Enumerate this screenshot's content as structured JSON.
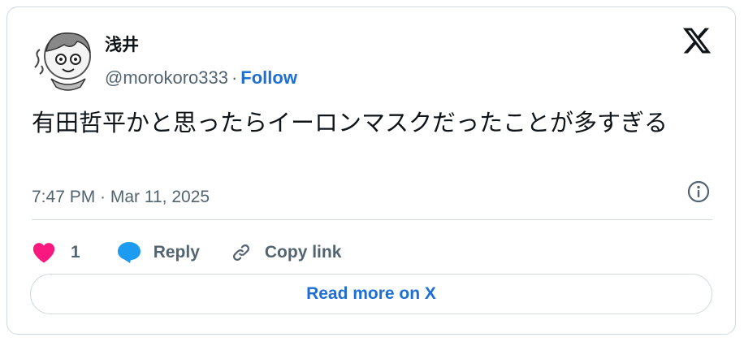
{
  "author": {
    "name": "浅井",
    "handle": "@morokoro333",
    "separator": "·",
    "follow_label": "Follow"
  },
  "tweet": {
    "text": "有田哲平かと思ったらイーロンマスクだったことが多すぎる",
    "timestamp": "7:47 PM · Mar 11, 2025"
  },
  "actions": {
    "like_count": "1",
    "reply_label": "Reply",
    "copy_link_label": "Copy link"
  },
  "read_more_label": "Read more on X",
  "colors": {
    "like": "#f91880",
    "reply": "#1d9bf0",
    "link": "#1d6fd6",
    "muted": "#536471",
    "border": "#cfd9de"
  },
  "icons": [
    "avatar",
    "x-logo-icon",
    "info-icon",
    "heart-icon",
    "reply-bubble-icon",
    "link-icon"
  ]
}
